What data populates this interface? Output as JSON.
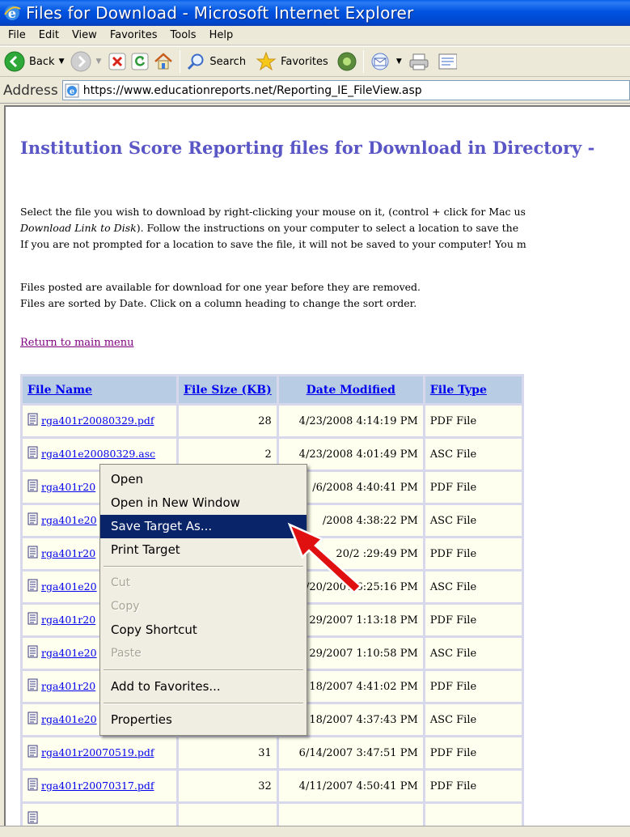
{
  "window": {
    "title": "Files for Download - Microsoft Internet Explorer"
  },
  "menubar": [
    "File",
    "Edit",
    "View",
    "Favorites",
    "Tools",
    "Help"
  ],
  "toolbar": {
    "back_label": "Back",
    "search_label": "Search",
    "favorites_label": "Favorites"
  },
  "address": {
    "label": "Address",
    "url": "https://www.educationreports.net/Reporting_IE_FileView.asp"
  },
  "page": {
    "heading": "Institution Score Reporting files for Download in Directory -",
    "instructions": {
      "line1": "Select the file you wish to download by right-clicking your mouse on it, (control + click for Mac us",
      "line2_italic": "Download Link to Disk",
      "line2_rest": "). Follow the instructions on your computer to select a location to save the",
      "line3": "If you are not prompted for a location to save the file, it will not be saved to your computer! You m"
    },
    "notes": {
      "line1": "Files posted are available for download for one year before they are removed.",
      "line2": "Files are sorted by Date. Click on a column heading to change the sort order."
    },
    "return_link": "Return to main menu"
  },
  "table": {
    "headers": [
      "File Name",
      "File Size (KB)",
      "Date Modified",
      "File Type"
    ],
    "rows": [
      {
        "name": "rga401r20080329.pdf",
        "size": "28",
        "date": "4/23/2008 4:14:19 PM",
        "type": "PDF File"
      },
      {
        "name": "rga401e20080329.asc",
        "size": "2",
        "date": "4/23/2008 4:01:49 PM",
        "type": "ASC File"
      },
      {
        "name": "rga401r20",
        "size": "",
        "date": "/6/2008 4:40:41 PM",
        "type": "PDF File"
      },
      {
        "name": "rga401e20",
        "size": "",
        "date": "/2008 4:38:22 PM",
        "type": "ASC File"
      },
      {
        "name": "rga401r20",
        "size": "",
        "date": "20/2  :29:49 PM",
        "type": "PDF File"
      },
      {
        "name": "rga401e20",
        "size": "",
        "date": "/20/2007 6:25:16 PM",
        "type": "ASC File"
      },
      {
        "name": "rga401r20",
        "size": "",
        "date": "29/2007 1:13:18 PM",
        "type": "PDF File"
      },
      {
        "name": "rga401e20",
        "size": "",
        "date": "29/2007 1:10:58 PM",
        "type": "ASC File"
      },
      {
        "name": "rga401r20",
        "size": "",
        "date": "18/2007 4:41:02 PM",
        "type": "PDF File"
      },
      {
        "name": "rga401e20",
        "size": "",
        "date": "18/2007 4:37:43 PM",
        "type": "ASC File"
      },
      {
        "name": "rga401r20070519.pdf",
        "size": "31",
        "date": "6/14/2007 3:47:51 PM",
        "type": "PDF File"
      },
      {
        "name": "rga401r20070317.pdf",
        "size": "32",
        "date": "4/11/2007 4:50:41 PM",
        "type": "PDF File"
      },
      {
        "name": "",
        "size": "",
        "date": "",
        "type": ""
      }
    ]
  },
  "context_menu": {
    "items": [
      {
        "label": "Open",
        "state": "normal"
      },
      {
        "label": "Open in New Window",
        "state": "normal"
      },
      {
        "label": "Save Target As...",
        "state": "highlighted"
      },
      {
        "label": "Print Target",
        "state": "normal"
      },
      {
        "label": "Cut",
        "state": "disabled"
      },
      {
        "label": "Copy",
        "state": "disabled"
      },
      {
        "label": "Copy Shortcut",
        "state": "normal"
      },
      {
        "label": "Paste",
        "state": "disabled"
      },
      {
        "label": "Add to Favorites...",
        "state": "normal"
      },
      {
        "label": "Properties",
        "state": "normal"
      }
    ]
  },
  "colors": {
    "titlebar": "#0053e1",
    "heading": "#5a56c6",
    "menu_highlight": "#0a246a",
    "annotation_arrow": "#e11010",
    "table_header_bg": "#b8cce4",
    "table_cell_bg": "#ffffef"
  },
  "icons": [
    "ie-logo-icon",
    "back-icon",
    "forward-icon",
    "stop-icon",
    "refresh-icon",
    "home-icon",
    "search-icon",
    "favorites-star-icon",
    "media-icon",
    "mail-icon",
    "print-icon",
    "edit-icon",
    "page-icon",
    "document-icon",
    "red-arrow-icon"
  ]
}
